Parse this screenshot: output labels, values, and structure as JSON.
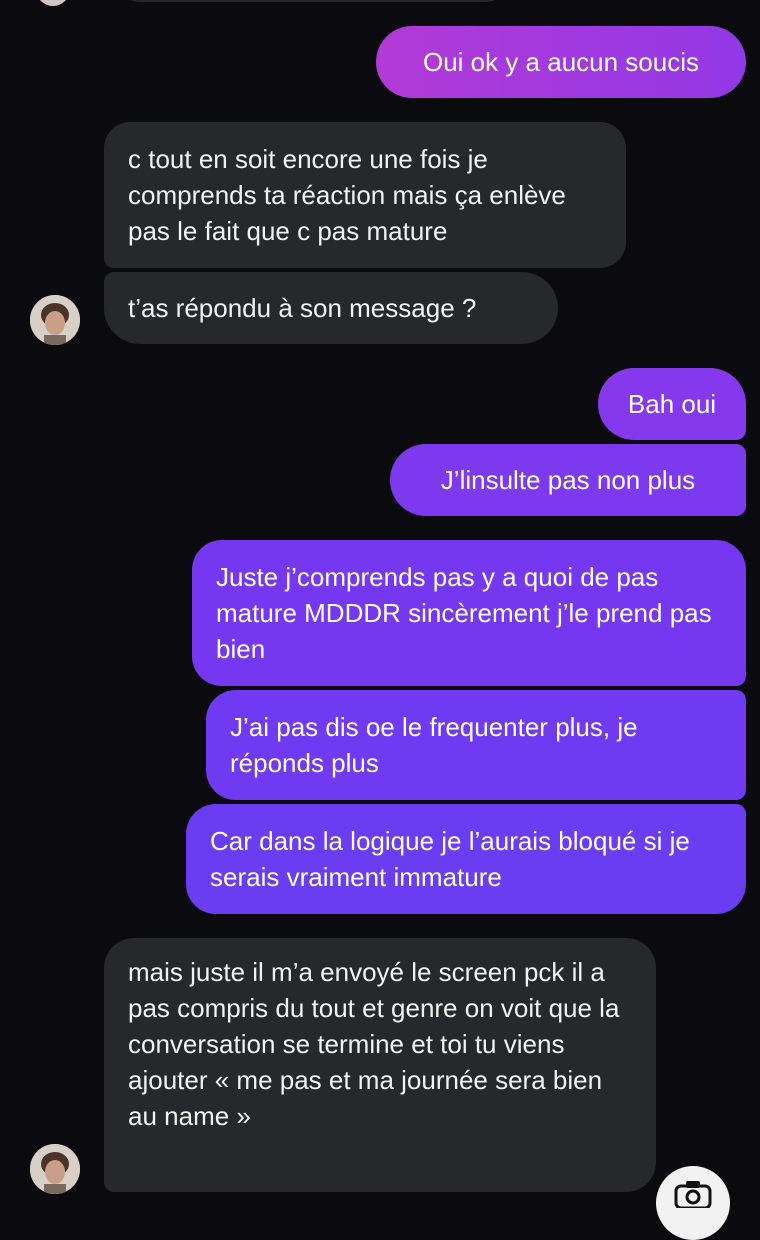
{
  "messages": [
    {
      "side": "out",
      "text": "Oui ok y a aucun soucis"
    },
    {
      "side": "in",
      "text": "c tout en soit encore une fois je comprends ta réaction mais ça enlève pas le fait que c pas mature"
    },
    {
      "side": "in",
      "text": "t’as répondu à son message ?"
    },
    {
      "side": "out",
      "text": "Bah oui"
    },
    {
      "side": "out",
      "text": "J’linsulte pas non plus"
    },
    {
      "side": "out",
      "text": "Juste j’comprends pas y a quoi de pas mature MDDDR sincèrement j’le prend pas bien"
    },
    {
      "side": "out",
      "text": "J’ai pas dis oe le frequenter plus, je réponds plus"
    },
    {
      "side": "out",
      "text": "Car dans la logique je l’aurais bloqué si je serais vraiment immature"
    },
    {
      "side": "in",
      "text": "mais juste il m’a envoyé le screen pck il a pas compris du tout et genre on voit que la conversation se termine et toi tu viens ajouter « me pas et ma journée sera bien au name »"
    }
  ],
  "colors": {
    "background": "#0b0b0f",
    "incoming_bubble": "#27282c",
    "outgoing_gradient_top": "#a53ad8",
    "outgoing_gradient_bottom": "#6d3cf2"
  },
  "icons": {
    "avatar": "avatar-photo",
    "composer": "camera-icon"
  }
}
